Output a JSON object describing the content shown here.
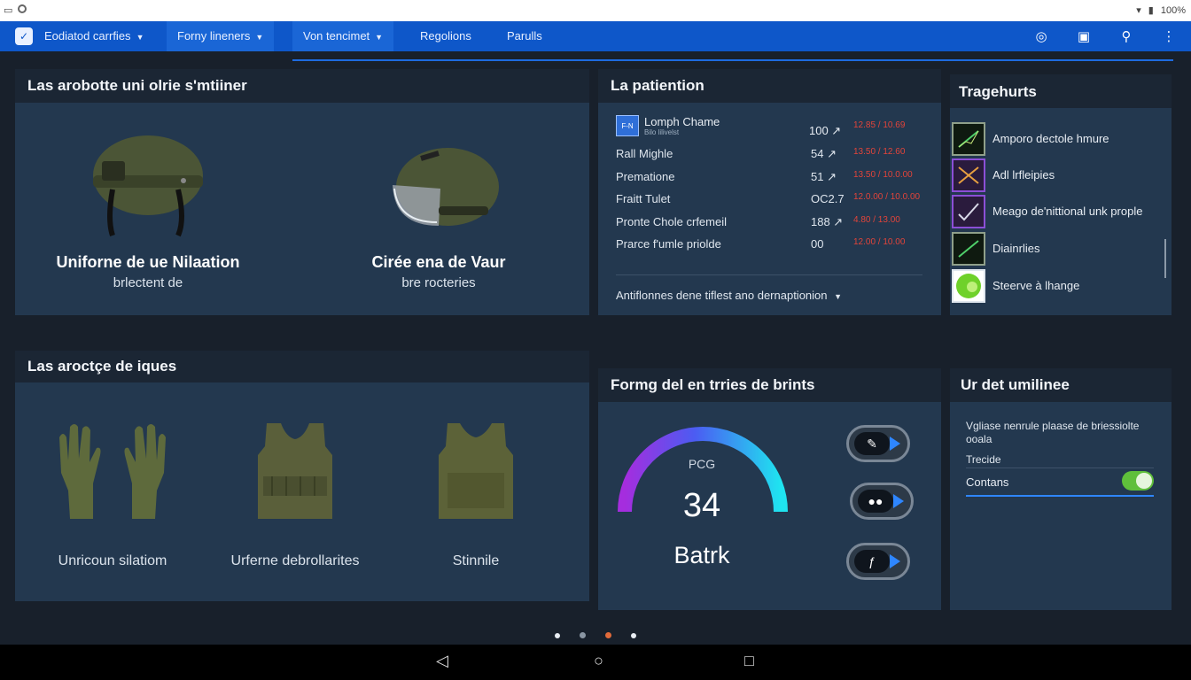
{
  "nav": {
    "logo_glyph": "✓",
    "items": [
      {
        "label": "Eodiatod carrfies",
        "dropdown": true
      },
      {
        "label": "Forny lineners",
        "dropdown": true
      },
      {
        "label": "Von tencimet",
        "dropdown": true
      },
      {
        "label": "Regolions",
        "dropdown": false
      },
      {
        "label": "Parulls",
        "dropdown": false
      }
    ],
    "icons": [
      "instagram-icon",
      "calendar-icon",
      "search-icon",
      "more-vert-icon"
    ]
  },
  "panel_top_left": {
    "title": "Las arobotte uni olrie s'mtiiner",
    "items": [
      {
        "title": "Uniforne de ue Nilaation",
        "sub": "brlectent de",
        "icon": "helmet-icon"
      },
      {
        "title": "Cirée ena de Vaur",
        "sub": "bre rocteries",
        "icon": "visor-helmet-icon"
      }
    ]
  },
  "panel_stats": {
    "title": "La patiention",
    "header": {
      "label": "Lomph Chame",
      "sublabel": "Bilo lilivelst",
      "badge": "F-N"
    },
    "rows": [
      {
        "label": "Rall Mighle",
        "value": "54 ↗",
        "note": "13.50 / 12.60"
      },
      {
        "label": "Prematione",
        "value": "51 ↗",
        "note": "13.50 / 10.0.00"
      },
      {
        "label": "Fraitt Tulet",
        "value": "OC2.7",
        "note": "12.0.00 / 10.0.00"
      },
      {
        "label": "Pronte Chole crfemeil",
        "value": "188 ↗",
        "note": "4.80 / 13.00"
      },
      {
        "label": "Prarce f'umle priolde",
        "value": "00",
        "note": "12.00 / 10.00"
      }
    ],
    "header_value": "100 ↗",
    "header_note": "12.85 / 10.69",
    "footer": "Antiflonnes dene tiflest ano dernaptionion"
  },
  "panel_list": {
    "title": "Tragehurts",
    "items": [
      {
        "label": "Amporo dectole hmure",
        "icon": "chart-line-icon",
        "color": "#3d8c3a"
      },
      {
        "label": "Adl lrfleipies",
        "icon": "cross-chart-icon",
        "color": "#8b4fd6"
      },
      {
        "label": "Meago de'nittional unk prople",
        "icon": "check-chart-icon",
        "color": "#8b4fd6"
      },
      {
        "label": "Diainrlies",
        "icon": "trend-icon",
        "color": "#3d8c3a"
      },
      {
        "label": "Steerve à lhange",
        "icon": "green-circle-icon",
        "color": "#6fd12a"
      }
    ]
  },
  "panel_bottom_left": {
    "title": "Las aroctçe de iques",
    "items": [
      {
        "name": "Unricoun silatiom",
        "icon": "gloves-icon"
      },
      {
        "name": "Urferne debrollarites",
        "icon": "vest-icon"
      },
      {
        "name": "Stinnile",
        "icon": "armor-plate-icon"
      }
    ]
  },
  "panel_gauge": {
    "title": "Formg del en trries de brints",
    "gauge_label": "PCG",
    "gauge_value": "34",
    "gauge_caption": "Batrk",
    "gauge_fraction": 0.78,
    "controls": [
      "marker-icon",
      "dots-icon",
      "pen-icon"
    ]
  },
  "panel_settings": {
    "title": "Ur det umilinee",
    "description": "Vgliase nenrule plaase de briessiolte ooala",
    "row1": "Trecide",
    "row2": "Contans",
    "toggle_on": true
  },
  "status": {
    "left_icons": [
      "sim-icon",
      "sync-icon"
    ],
    "right_text": "100%"
  },
  "page_dots": 4,
  "active_dot": 3
}
